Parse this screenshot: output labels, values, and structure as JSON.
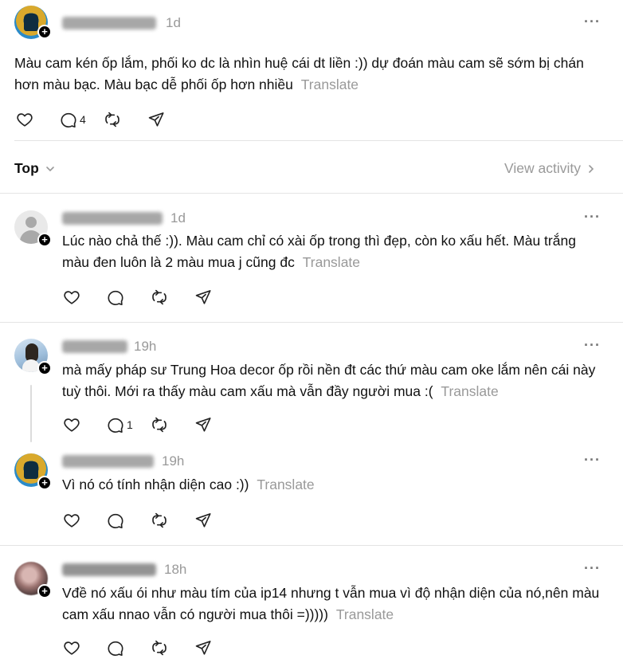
{
  "main_post": {
    "time": "1d",
    "text": "Màu cam kén ốp lắm, phối ko dc là nhìn huệ cái dt liền :)) dự đoán màu cam sẽ sớm bị chán hơn màu bạc. Màu bạc dễ phối ốp hơn nhiều",
    "translate": "Translate",
    "reply_count": "4"
  },
  "sort_bar": {
    "label": "Top",
    "view_activity": "View activity"
  },
  "replies": [
    {
      "time": "1d",
      "text": "Lúc nào chả thế :)). Màu cam chỉ có xài ốp trong thì đẹp, còn ko xấu hết. Màu trắng màu đen luôn là 2 màu mua j cũng đc",
      "translate": "Translate",
      "reply_count": ""
    },
    {
      "time": "19h",
      "text": "mà mấy pháp sư Trung Hoa decor ốp rồi nền đt các thứ màu cam oke lắm nên cái này tuỳ thôi. Mới ra thấy màu cam xấu mà vẫn đầy người mua :(",
      "translate": "Translate",
      "reply_count": "1"
    },
    {
      "time": "19h",
      "text": "Vì nó có tính nhận diện cao :))",
      "translate": "Translate",
      "reply_count": ""
    },
    {
      "time": "18h",
      "text": "Vđề nó xấu ói như màu tím của ip14 nhưng t vẫn mua vì độ nhận diện của nó,nên màu cam xấu nnao vẫn có người mua thôi =)))))",
      "translate": "Translate",
      "reply_count": ""
    }
  ],
  "icons": {
    "like": "heart-icon",
    "reply": "comment-icon",
    "repost": "repost-icon",
    "share": "share-icon",
    "more": "more-icon"
  },
  "colors": {
    "text": "#111111",
    "muted": "#999999",
    "divider": "#e4e4e4"
  }
}
